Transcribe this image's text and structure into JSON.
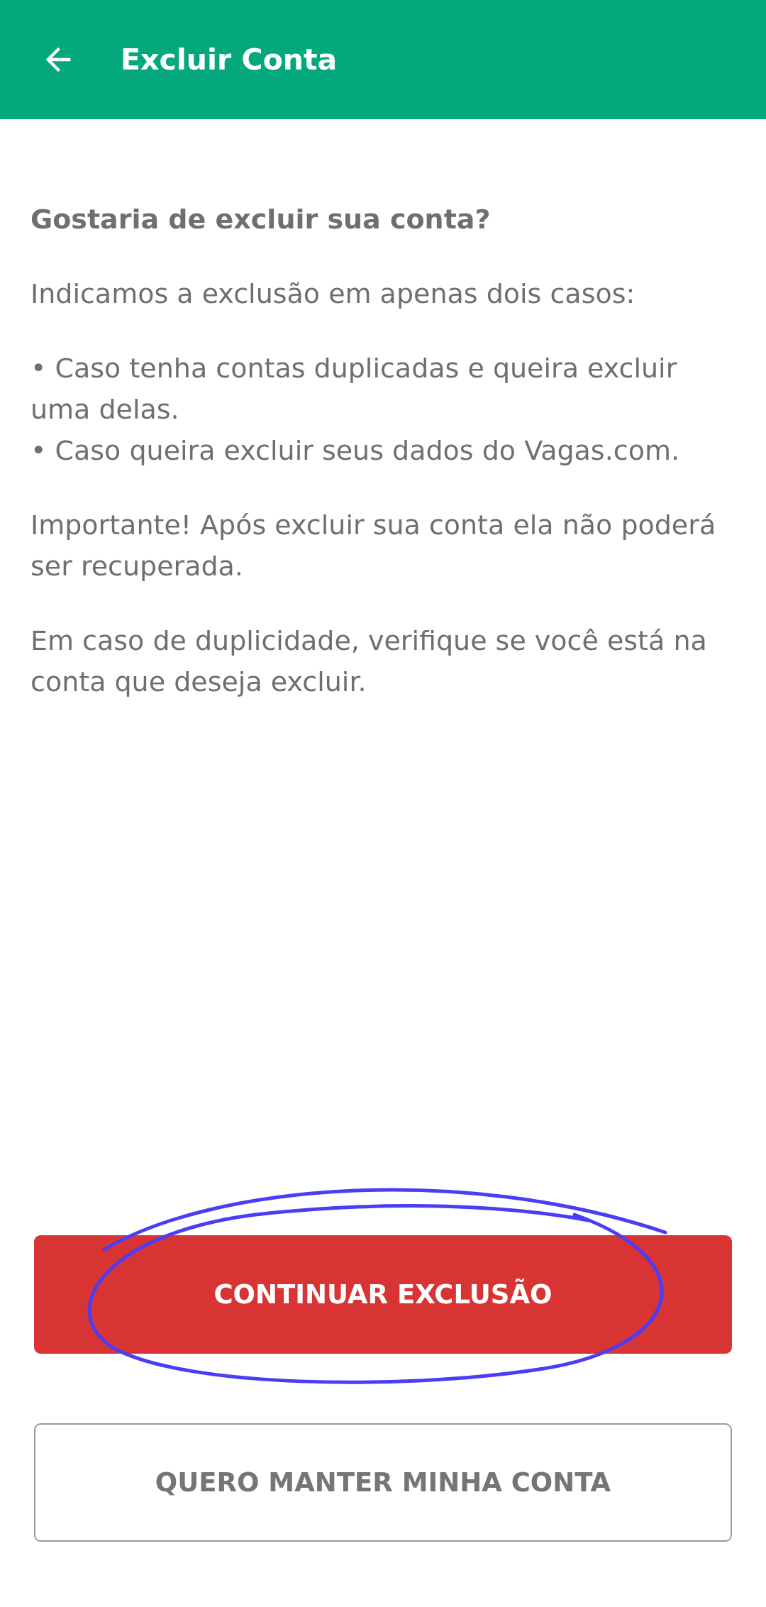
{
  "app_bar": {
    "title": "Excluir Conta"
  },
  "blocks": [
    {
      "kind": "heading",
      "text": "Gostaria de excluir sua conta?"
    },
    {
      "kind": "paragraph",
      "text": "Indicamos a exclusão em apenas dois casos:"
    },
    {
      "kind": "bullets",
      "items": [
        "• Caso tenha contas duplicadas e queira excluir uma delas.",
        "• Caso queira excluir seus dados do Vagas.com."
      ]
    },
    {
      "kind": "paragraph",
      "text": "Importante! Após excluir sua conta ela não poderá ser recuperada."
    },
    {
      "kind": "paragraph",
      "text": "Em caso de duplicidade, verifique se você está na conta que deseja excluir."
    }
  ],
  "buttons": [
    {
      "label": "CONTINUAR EXCLUSÃO",
      "kind": "primary"
    },
    {
      "label": "QUERO MANTER MINHA CONTA",
      "kind": "outline"
    }
  ]
}
